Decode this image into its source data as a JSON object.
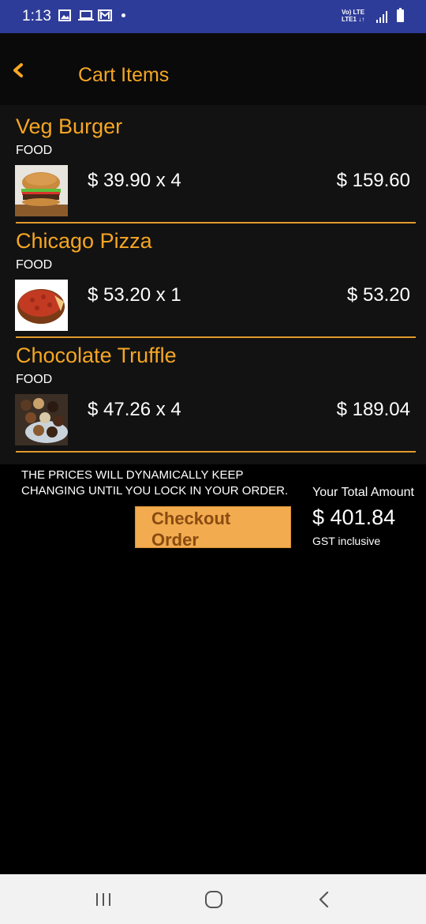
{
  "status_bar": {
    "time": "1:13",
    "icons": [
      "gallery-icon",
      "laptop-icon",
      "mail-icon",
      "dot-icon",
      "lte-icon",
      "signal-icon",
      "battery-icon"
    ],
    "network_line1": "Vo) LTE",
    "network_line2": "LTE1 ↓↑"
  },
  "header": {
    "back_icon": "chevron-left-icon",
    "title": "Cart Items"
  },
  "cart": {
    "items": [
      {
        "name": "Veg Burger",
        "category": "FOOD",
        "unit_line": "$ 39.90 x 4",
        "total": "$ 159.60",
        "image": "burger-image"
      },
      {
        "name": "Chicago Pizza",
        "category": "FOOD",
        "unit_line": "$ 53.20 x 1",
        "total": "$ 53.20",
        "image": "pizza-image"
      },
      {
        "name": "Chocolate Truffle",
        "category": "FOOD",
        "unit_line": "$ 47.26 x 4",
        "total": "$ 189.04",
        "image": "truffle-image"
      }
    ]
  },
  "footer": {
    "notice_line1": "THE PRICES WILL DYNAMICALLY KEEP",
    "notice_line2": "CHANGING UNTIL YOU LOCK IN YOUR ORDER.",
    "total_label": "Your Total Amount",
    "total_amount": "$ 401.84",
    "gst_note": "GST inclusive",
    "checkout_label": "Checkout Order"
  },
  "nav_bar": {
    "icons": [
      "recent-apps-icon",
      "home-icon",
      "back-icon"
    ]
  },
  "colors": {
    "accent": "#f5a623",
    "status_bar": "#2e3c99",
    "button": "#f2ab4f",
    "button_text": "#8a4b10"
  }
}
